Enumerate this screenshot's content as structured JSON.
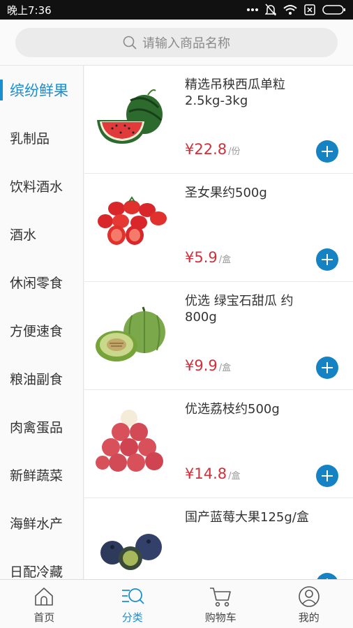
{
  "status_bar": {
    "time": "晚上7:36"
  },
  "search": {
    "placeholder": "请输入商品名称"
  },
  "sidebar": {
    "items": [
      {
        "label": "缤纷鲜果",
        "active": true
      },
      {
        "label": "乳制品"
      },
      {
        "label": "饮料酒水"
      },
      {
        "label": "酒水"
      },
      {
        "label": "休闲零食"
      },
      {
        "label": "方便速食"
      },
      {
        "label": "粮油副食"
      },
      {
        "label": "肉禽蛋品"
      },
      {
        "label": "新鲜蔬菜"
      },
      {
        "label": "海鲜水产"
      },
      {
        "label": "日配冷藏"
      }
    ]
  },
  "products": [
    {
      "title": "精选吊秧西瓜单粒2.5kg-3kg",
      "price": "¥22.8",
      "unit": "/份",
      "image": "watermelon"
    },
    {
      "title": "圣女果约500g",
      "price": "¥5.9",
      "unit": "/盒",
      "image": "cherry-tomatoes"
    },
    {
      "title": "优选 绿宝石甜瓜 约800g",
      "price": "¥9.9",
      "unit": "/盒",
      "image": "green-melon"
    },
    {
      "title": "优选荔枝约500g",
      "price": "¥14.8",
      "unit": "/盒",
      "image": "lychee"
    },
    {
      "title": "国产蓝莓大果125g/盒",
      "price": "",
      "unit": "",
      "image": "blueberries"
    }
  ],
  "tabs": [
    {
      "label": "首页",
      "icon": "home-icon"
    },
    {
      "label": "分类",
      "icon": "category-search-icon",
      "active": true
    },
    {
      "label": "购物车",
      "icon": "cart-icon"
    },
    {
      "label": "我的",
      "icon": "user-icon"
    }
  ],
  "colors": {
    "accent": "#1a8fd0",
    "price": "#d0303a",
    "add_button": "#1582c4"
  }
}
